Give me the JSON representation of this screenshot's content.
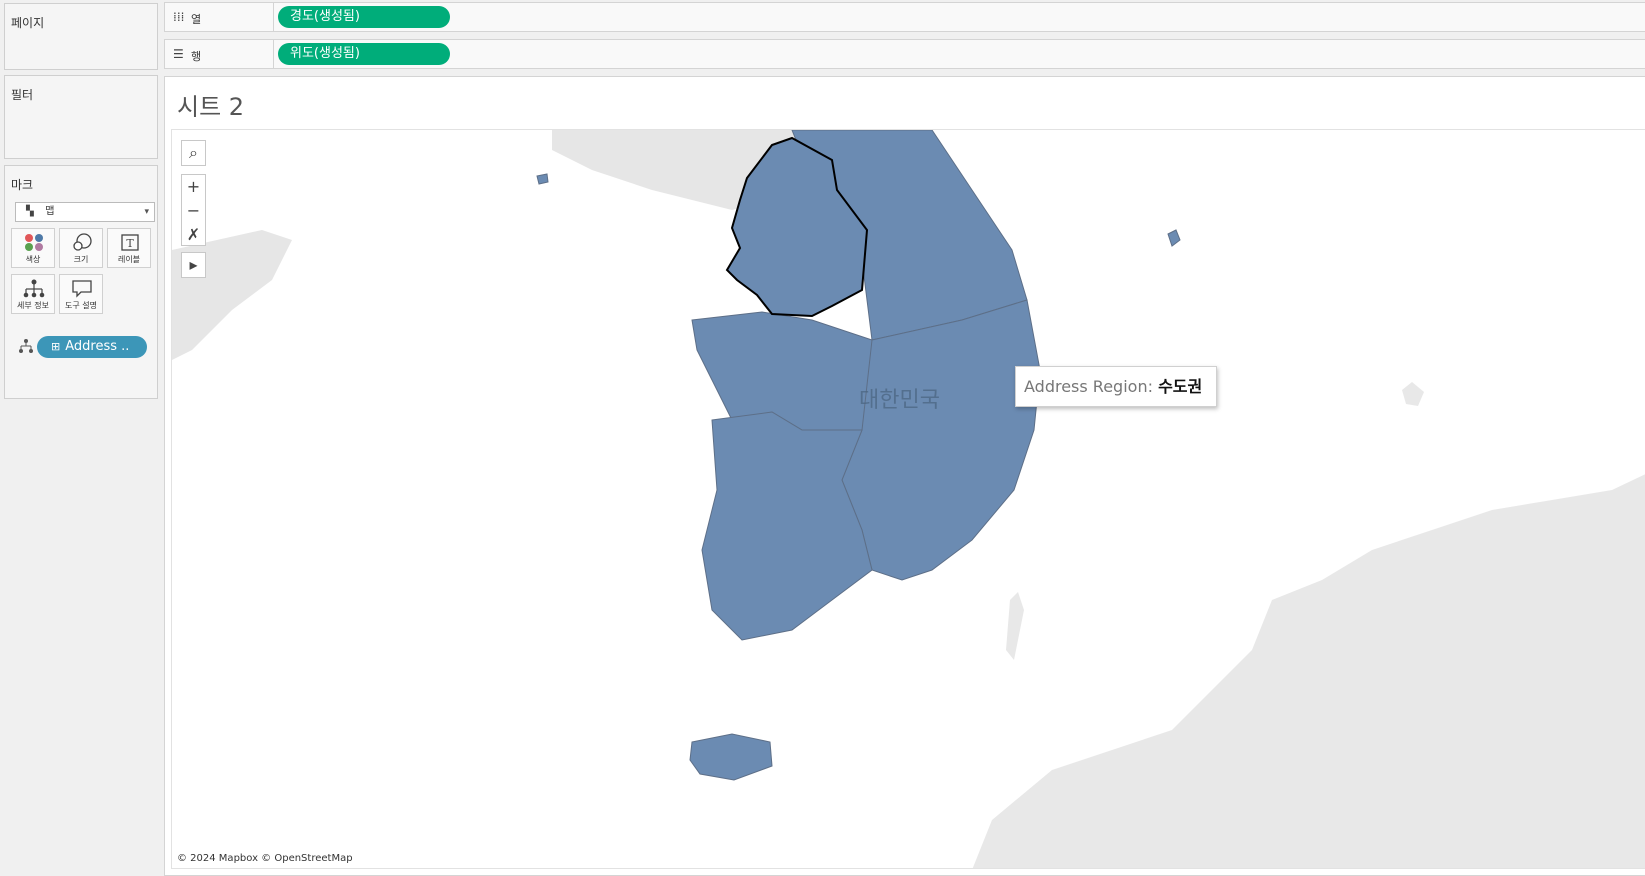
{
  "left_panels": {
    "pages_title": "페이지",
    "filters_title": "필터",
    "marks_title": "마크",
    "mark_type": "맵",
    "mark_cards": [
      {
        "label": "색상",
        "icon": "color-icon"
      },
      {
        "label": "크기",
        "icon": "size-icon"
      },
      {
        "label": "레이블",
        "icon": "label-icon"
      },
      {
        "label": "세부 정보",
        "icon": "detail-icon"
      },
      {
        "label": "도구 설명",
        "icon": "tooltip-icon"
      }
    ],
    "detail_pill": "Address .."
  },
  "shelves": {
    "columns_label": "열",
    "columns_pill": "경도(생성됨)",
    "rows_label": "행",
    "rows_pill": "위도(생성됨)"
  },
  "view": {
    "sheet_title": "시트 2",
    "map_controls": [
      "search-icon",
      "zoom-in-icon",
      "zoom-out-icon",
      "pan-select-icon",
      "expand-toolbar-icon"
    ],
    "tooltip_label": "Address Region:",
    "tooltip_value": "수도권",
    "country_label": "대한민국",
    "attribution": "© 2024 Mapbox © OpenStreetMap"
  },
  "colors": {
    "region_fill": "#6b8bb2",
    "shelf_pill": "#00ad7a",
    "detail_pill": "#3c96b8",
    "land_background": "#e7e7e7"
  }
}
